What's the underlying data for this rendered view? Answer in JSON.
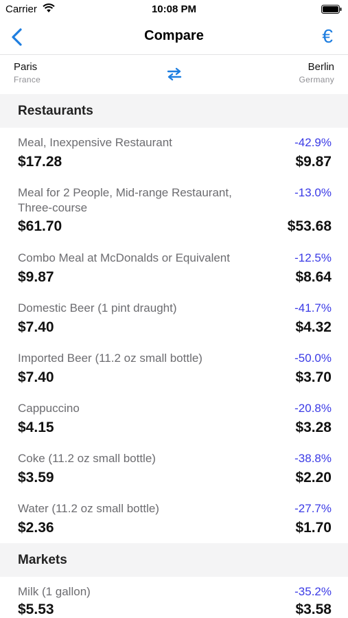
{
  "status_bar": {
    "carrier": "Carrier",
    "time": "10:08 PM"
  },
  "nav": {
    "title": "Compare",
    "currency_symbol": "€"
  },
  "cities": {
    "left": {
      "city": "Paris",
      "country": "France"
    },
    "right": {
      "city": "Berlin",
      "country": "Germany"
    }
  },
  "colors": {
    "accent": "#1e7ee0",
    "percent": "#3a3ae6",
    "section_bg": "#f4f4f5"
  },
  "sections": [
    {
      "title": "Restaurants",
      "items": [
        {
          "name": "Meal, Inexpensive Restaurant",
          "percent": "-42.9%",
          "price_left": "$17.28",
          "price_right": "$9.87"
        },
        {
          "name": "Meal for 2 People, Mid-range Restaurant, Three-course",
          "percent": "-13.0%",
          "price_left": "$61.70",
          "price_right": "$53.68"
        },
        {
          "name": "Combo Meal at McDonalds or Equivalent",
          "percent": "-12.5%",
          "price_left": "$9.87",
          "price_right": "$8.64"
        },
        {
          "name": "Domestic Beer (1 pint draught)",
          "percent": "-41.7%",
          "price_left": "$7.40",
          "price_right": "$4.32"
        },
        {
          "name": "Imported Beer (11.2 oz small bottle)",
          "percent": "-50.0%",
          "price_left": "$7.40",
          "price_right": "$3.70"
        },
        {
          "name": "Cappuccino",
          "percent": "-20.8%",
          "price_left": "$4.15",
          "price_right": "$3.28"
        },
        {
          "name": "Coke (11.2 oz small bottle)",
          "percent": "-38.8%",
          "price_left": "$3.59",
          "price_right": "$2.20"
        },
        {
          "name": "Water (11.2 oz small bottle)",
          "percent": "-27.7%",
          "price_left": "$2.36",
          "price_right": "$1.70"
        }
      ]
    },
    {
      "title": "Markets",
      "items": [
        {
          "name": "Milk (1 gallon)",
          "percent": "-35.2%",
          "price_left": "$5.53",
          "price_right": "$3.58"
        }
      ]
    }
  ]
}
